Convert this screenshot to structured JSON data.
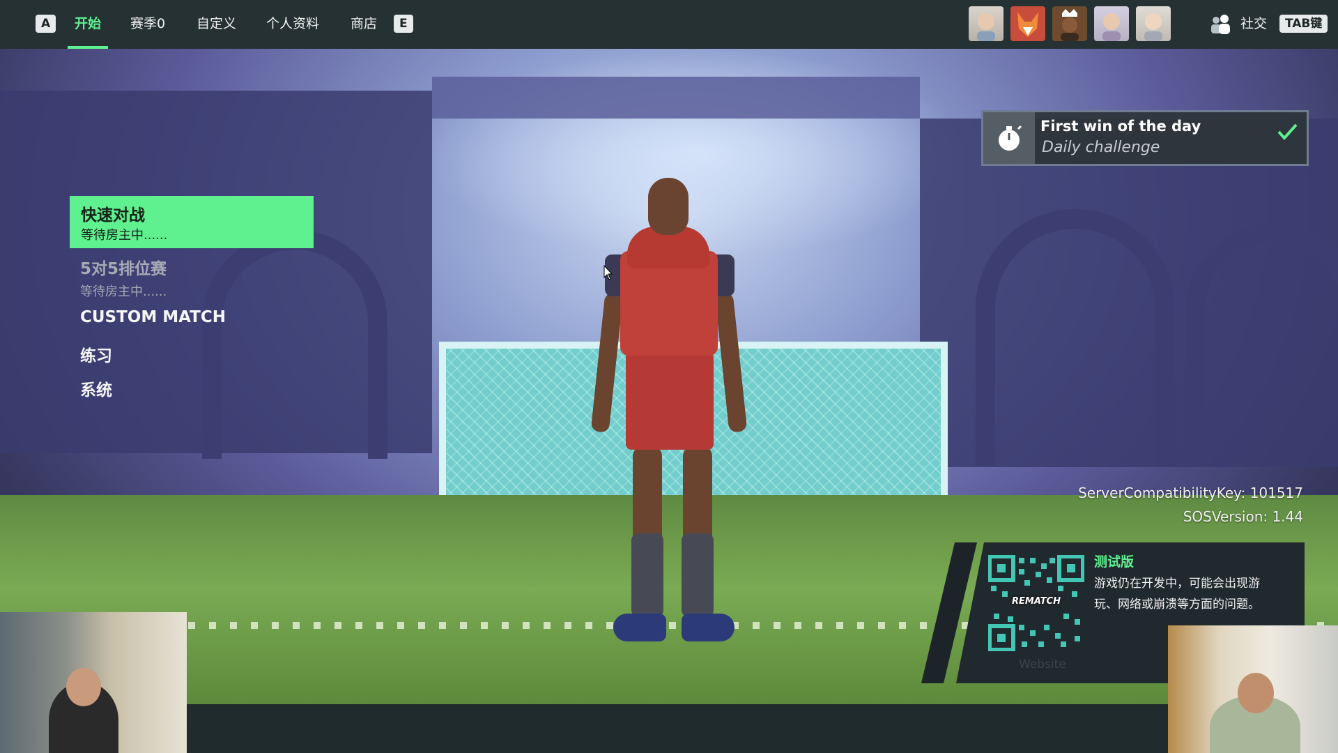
{
  "nav": {
    "left_key": "A",
    "right_key": "E",
    "tabs": [
      {
        "label": "开始",
        "active": true
      },
      {
        "label": "赛季0",
        "active": false
      },
      {
        "label": "自定义",
        "active": false
      },
      {
        "label": "个人资料",
        "active": false
      },
      {
        "label": "商店",
        "active": false
      }
    ],
    "avatars": [
      "player-avatar-1",
      "fox-avatar",
      "crowned-avatar",
      "player-avatar-4",
      "player-avatar-5"
    ],
    "social_label": "社交",
    "social_key": "TAB键",
    "accent_color": "#5ff08f"
  },
  "challenge": {
    "title": "First win of the day",
    "subtitle": "Daily challenge",
    "icon": "stopwatch-icon",
    "completed": true
  },
  "menu": {
    "items": [
      {
        "title": "快速对战",
        "subtitle": "等待房主中......",
        "state": "selected"
      },
      {
        "title": "5对5排位赛",
        "subtitle": "等待房主中......",
        "state": "disabled"
      },
      {
        "title": "CUSTOM MATCH",
        "state": "normal"
      },
      {
        "title": "练习",
        "state": "normal"
      },
      {
        "title": "系统",
        "state": "normal"
      }
    ]
  },
  "version": {
    "server_key": "ServerCompatibilityKey: 101517",
    "sos": "SOSVersion: 1.44"
  },
  "beta": {
    "qr_label": "REMATCH",
    "website_link": "Website",
    "title": "测试版",
    "description": "游戏仍在开发中，可能会出现游玩、网络或崩溃等方面的问题。"
  }
}
